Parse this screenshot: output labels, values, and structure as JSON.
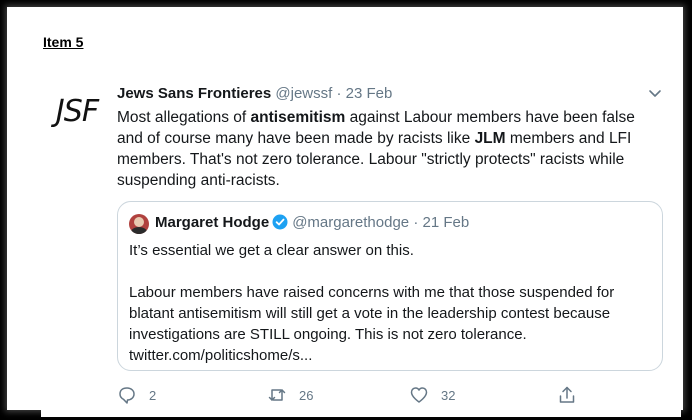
{
  "item_label": "Item 5",
  "tweet": {
    "avatar_text": "JSF",
    "author_name": "Jews Sans Frontieres",
    "handle": "@jewssf",
    "separator": "·",
    "date": "23 Feb",
    "text": {
      "p1": "Most allegations of ",
      "b1": "antisemitism",
      "p2": " against Labour members have been false and of course many have been made by racists like ",
      "b2": "JLM",
      "p3": " members and LFI members. That's not zero tolerance. Labour \"strictly protects\" racists while suspending anti-racists."
    },
    "quoted": {
      "author_name": "Margaret Hodge",
      "handle": "@margarethodge",
      "separator": "·",
      "date": "21 Feb",
      "paragraph1": "It’s essential we get a clear answer on this.",
      "paragraph2": "Labour members have raised concerns with me that those suspended for blatant antisemitism will still get a vote in the leadership contest because investigations are STILL ongoing. This is not zero tolerance. twitter.com/politicshome/s..."
    },
    "actions": {
      "reply_count": "2",
      "retweet_count": "26",
      "like_count": "32"
    }
  },
  "icons": [
    "chevron-down-icon",
    "verified-icon",
    "reply-icon",
    "retweet-icon",
    "like-icon",
    "share-icon"
  ],
  "colors": {
    "text": "#14171a",
    "muted": "#657786",
    "border": "#ccd6dd",
    "verified": "#1da1f2"
  }
}
